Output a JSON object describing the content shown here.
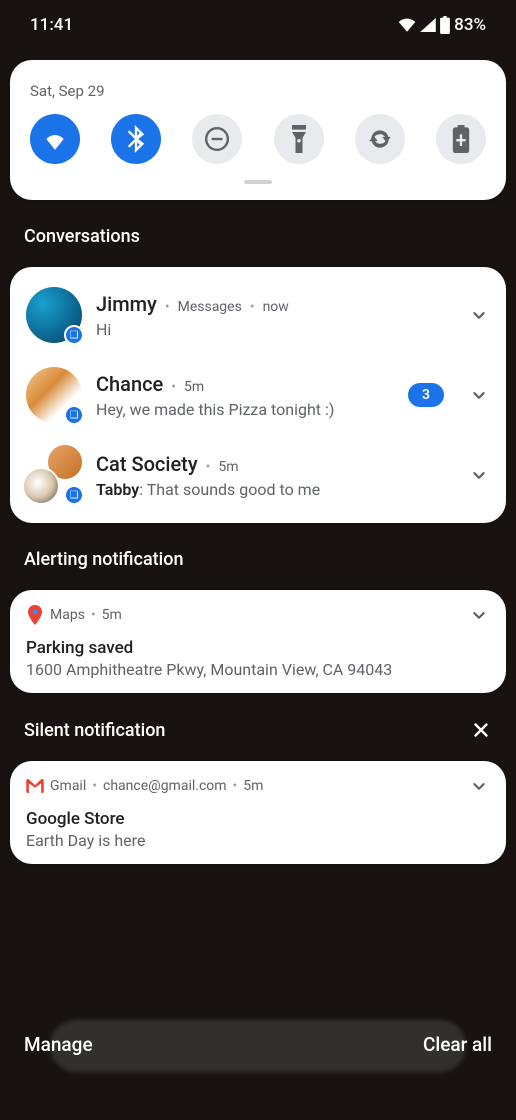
{
  "status": {
    "time": "11:41",
    "battery": "83%"
  },
  "quick_settings": {
    "date": "Sat, Sep 29",
    "toggles": [
      {
        "name": "wifi",
        "on": true
      },
      {
        "name": "bluetooth",
        "on": true
      },
      {
        "name": "dnd",
        "on": false
      },
      {
        "name": "flashlight",
        "on": false
      },
      {
        "name": "rotate",
        "on": false
      },
      {
        "name": "battery-saver",
        "on": false
      }
    ]
  },
  "sections": {
    "conversations_label": "Conversations",
    "alerting_label": "Alerting notification",
    "silent_label": "Silent notification"
  },
  "conversations": [
    {
      "name": "Jimmy",
      "app": "Messages",
      "time": "now",
      "preview": "Hi",
      "count": null
    },
    {
      "name": "Chance",
      "app": null,
      "time": "5m",
      "preview": "Hey, we made this Pizza tonight :)",
      "count": "3"
    },
    {
      "name": "Cat Society",
      "app": null,
      "time": "5m",
      "sender": "Tabby",
      "preview": "That sounds good to me",
      "count": null
    }
  ],
  "alerting": {
    "app": "Maps",
    "time": "5m",
    "title": "Parking saved",
    "body": "1600 Amphitheatre Pkwy, Mountain View, CA 94043"
  },
  "silent": {
    "app": "Gmail",
    "account": "chance@gmail.com",
    "time": "5m",
    "title": "Google Store",
    "body": "Earth Day is here"
  },
  "footer": {
    "manage": "Manage",
    "clear": "Clear all"
  }
}
